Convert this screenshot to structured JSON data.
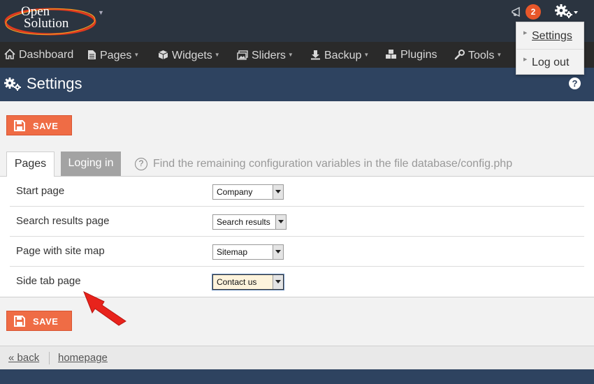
{
  "brand": {
    "line1": "Open",
    "line2": "Solution"
  },
  "notifications": {
    "count": "2"
  },
  "user_menu": {
    "settings_label": "Settings",
    "logout_label": "Log out"
  },
  "nav": {
    "dashboard": "Dashboard",
    "pages": "Pages",
    "widgets": "Widgets",
    "sliders": "Sliders",
    "backup": "Backup",
    "plugins": "Plugins",
    "tools": "Tools"
  },
  "header": {
    "title": "Settings",
    "help": "?"
  },
  "actions": {
    "save_label": "SAVE"
  },
  "tabs": {
    "pages": "Pages",
    "login": "Loging in",
    "info": "Find the remaining configuration variables in the file database/config.php"
  },
  "settings_rows": [
    {
      "label": "Start page",
      "value": "Company"
    },
    {
      "label": "Search results page",
      "value": "Search results"
    },
    {
      "label": "Page with site map",
      "value": "Sitemap"
    },
    {
      "label": "Side tab page",
      "value": "Contact us"
    }
  ],
  "footer": {
    "back": "« back",
    "homepage": "homepage"
  },
  "colors": {
    "topbar": "#2b3440",
    "navbar": "#2a2a2a",
    "header": "#2e4360",
    "accent": "#ef6c45",
    "badge": "#e8572a",
    "annotation_arrow": "#e8231c"
  }
}
